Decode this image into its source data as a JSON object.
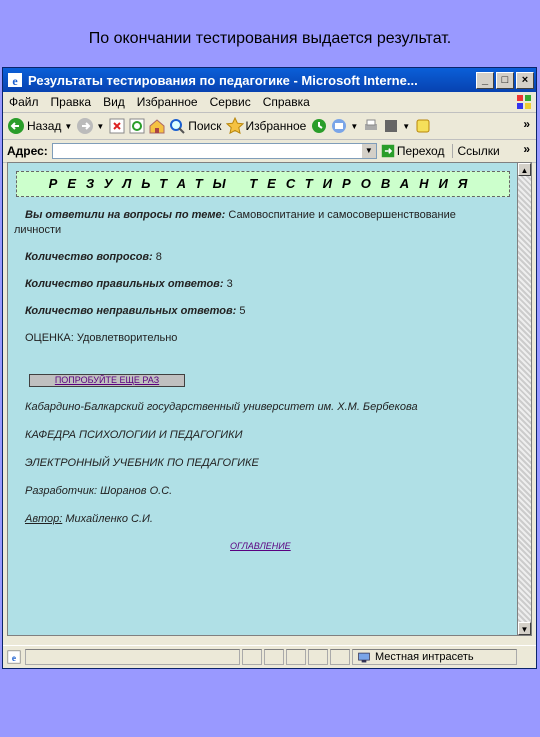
{
  "slide": {
    "caption": "По окончании тестирования выдается результат."
  },
  "window": {
    "title": "Результаты тестирования по педагогике - Microsoft Interne...",
    "buttons": {
      "minimize": "_",
      "maximize": "□",
      "close": "×"
    }
  },
  "menu": [
    "Файл",
    "Правка",
    "Вид",
    "Избранное",
    "Сервис",
    "Справка"
  ],
  "toolbar": {
    "back": "Назад",
    "search": "Поиск",
    "favorites": "Избранное",
    "more": "»"
  },
  "address": {
    "label": "Адрес:",
    "value": "",
    "go": "Переход",
    "links": "Ссылки",
    "more": "»"
  },
  "page": {
    "heading": "РЕЗУЛЬТАТЫ ТЕСТИРОВАНИЯ",
    "topic_label": "Вы ответили на вопросы по теме:",
    "topic_value": "Самовоспитание и самосовершенствование",
    "topic_value_cont": "личности",
    "questions_label": "Количество вопросов:",
    "questions_value": "8",
    "correct_label": "Количество правильных ответов:",
    "correct_value": "3",
    "wrong_label": "Количество неправильных ответов:",
    "wrong_value": "5",
    "grade_label": "ОЦЕНКА:",
    "grade_value": "Удовлетворительно",
    "restart_button": "ПОПРОБУЙТЕ ЕЩЕ РАЗ",
    "university": "Кабардино-Балкарский государственный университет им. Х.М. Бербекова",
    "department": "КАФЕДРА ПСИХОЛОГИИ И ПЕДАГОГИКИ",
    "textbook": "ЭЛЕКТРОННЫЙ УЧЕБНИК ПО ПЕДАГОГИКЕ",
    "developer_label": "Разработчик:",
    "developer_value": "Шоранов О.С.",
    "author_label": "Автор:",
    "author_value": "Михайленко С.И.",
    "toc_link": "ОГЛАВЛЕНИЕ"
  },
  "status": {
    "zone": "Местная интрасеть"
  }
}
